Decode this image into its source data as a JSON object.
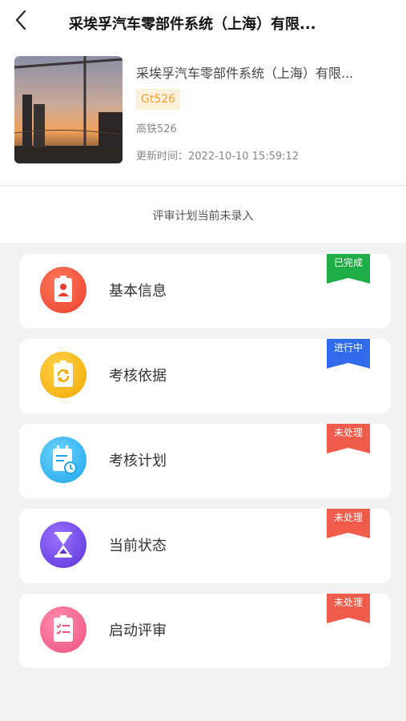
{
  "header": {
    "title": "采埃孚汽车零部件系统（上海）有限..."
  },
  "info": {
    "company": "采埃孚汽车零部件系统（上海）有限...",
    "code": "Gt526",
    "sub_name": "高铁526",
    "updated": "更新时间：2022-10-10 15:59:12"
  },
  "notice": "评审计划当前未录入",
  "cards": [
    {
      "label": "基本信息",
      "status": "已完成",
      "status_color": "#1fad47",
      "icon": "id-badge-icon",
      "icon_color": "#f0503a"
    },
    {
      "label": "考核依据",
      "status": "进行中",
      "status_color": "#2f6bea",
      "icon": "refresh-clipboard-icon",
      "icon_color": "#f4b400"
    },
    {
      "label": "考核计划",
      "status": "未处理",
      "status_color": "#f05c4b",
      "icon": "calendar-clock-icon",
      "icon_color": "#2db6f0"
    },
    {
      "label": "当前状态",
      "status": "未处理",
      "status_color": "#f05c4b",
      "icon": "hourglass-icon",
      "icon_color": "#6f45e8"
    },
    {
      "label": "启动评审",
      "status": "未处理",
      "status_color": "#f05c4b",
      "icon": "checklist-icon",
      "icon_color": "#f4608c"
    }
  ]
}
